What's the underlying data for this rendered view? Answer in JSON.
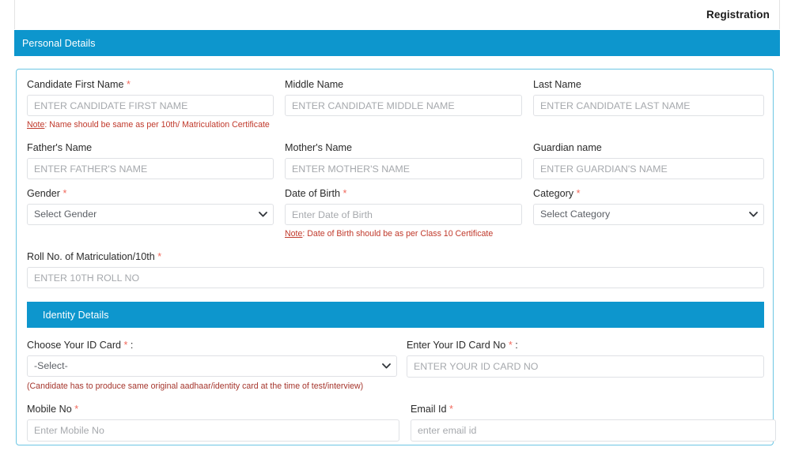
{
  "header": {
    "title": "Registration"
  },
  "sections": {
    "personal": {
      "title": "Personal Details"
    },
    "identity": {
      "title": "Identity Details"
    }
  },
  "personal_details": {
    "first_name": {
      "label": "Candidate First Name",
      "required_marker": "*",
      "placeholder": "ENTER CANDIDATE FIRST NAME",
      "value": ""
    },
    "middle_name": {
      "label": "Middle Name",
      "placeholder": "ENTER CANDIDATE MIDDLE NAME",
      "value": ""
    },
    "last_name": {
      "label": "Last Name",
      "placeholder": "ENTER CANDIDATE LAST NAME",
      "value": ""
    },
    "name_note_prefix": "Note",
    "name_note_text": ": Name should be same as per 10th/ Matriculation Certificate",
    "father_name": {
      "label": "Father's Name",
      "placeholder": "ENTER FATHER'S NAME",
      "value": ""
    },
    "mother_name": {
      "label": "Mother's Name",
      "placeholder": "ENTER MOTHER'S NAME",
      "value": ""
    },
    "guardian_name": {
      "label": "Guardian name",
      "placeholder": "ENTER GUARDIAN'S NAME",
      "value": ""
    },
    "gender": {
      "label": "Gender",
      "required_marker": "*",
      "selected": "Select Gender",
      "options": [
        "Select Gender"
      ]
    },
    "dob": {
      "label": "Date of Birth",
      "required_marker": "*",
      "placeholder": "Enter Date of Birth",
      "value": ""
    },
    "dob_note_prefix": "Note",
    "dob_note_text": ": Date of Birth should be as per Class 10 Certificate",
    "category": {
      "label": "Category",
      "required_marker": "*",
      "selected": "Select Category",
      "options": [
        "Select Category"
      ]
    },
    "roll_no": {
      "label": "Roll No. of Matriculation/10th",
      "required_marker": "*",
      "placeholder": "ENTER 10TH ROLL NO",
      "value": ""
    }
  },
  "identity_details": {
    "id_card": {
      "label": "Choose Your ID Card",
      "required_marker": "*",
      "colon": ":",
      "selected": "-Select-",
      "options": [
        "-Select-"
      ]
    },
    "id_card_no": {
      "label": "Enter Your ID Card No",
      "required_marker": "*",
      "colon": ":",
      "placeholder": "ENTER YOUR ID CARD NO",
      "value": ""
    },
    "id_note": "(Candidate has to produce same original aadhaar/identity card at the time of test/interview)",
    "mobile": {
      "label": "Mobile No",
      "required_marker": "*",
      "placeholder": "Enter Mobile No",
      "value": ""
    },
    "email": {
      "label": "Email Id",
      "required_marker": "*",
      "placeholder": "enter email id",
      "value": ""
    }
  },
  "colors": {
    "section_blue": "#0d96cd",
    "card_border": "#6cc6e4",
    "required_red": "#f1675a",
    "note_red": "#c0392b"
  },
  "icons": {
    "chevron_down": "chevron-down-icon"
  }
}
